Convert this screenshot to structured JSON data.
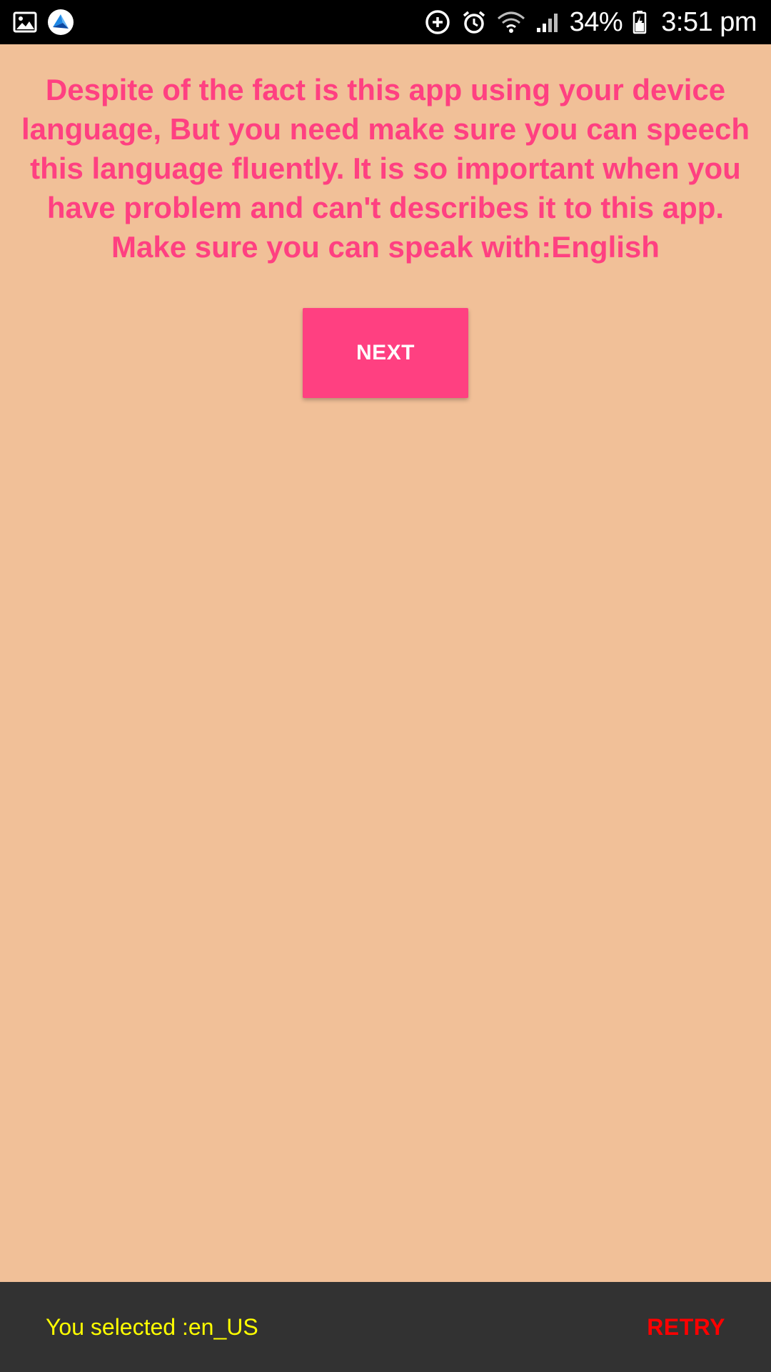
{
  "status_bar": {
    "left_icons": [
      "image-icon",
      "app-logo-icon"
    ],
    "right_icons": [
      "data-saver-icon",
      "alarm-icon",
      "wifi-icon",
      "signal-icon",
      "battery-charging-icon"
    ],
    "battery": "34%",
    "time": "3:51 pm"
  },
  "main": {
    "message": "Despite of the fact is this app using your device language, But you need make sure you can speech this language fluently. It is so important when you have problem and can't describes it to this app.",
    "requirement": "Make sure you can speak with:English",
    "next_label": "NEXT"
  },
  "snackbar": {
    "text": "You selected :en_US",
    "action_label": "RETRY"
  },
  "colors": {
    "background": "#f1c098",
    "accent": "#ff4081",
    "snackbar_bg": "#323232",
    "snackbar_text": "#ffff00",
    "snackbar_action": "#ff0000"
  }
}
